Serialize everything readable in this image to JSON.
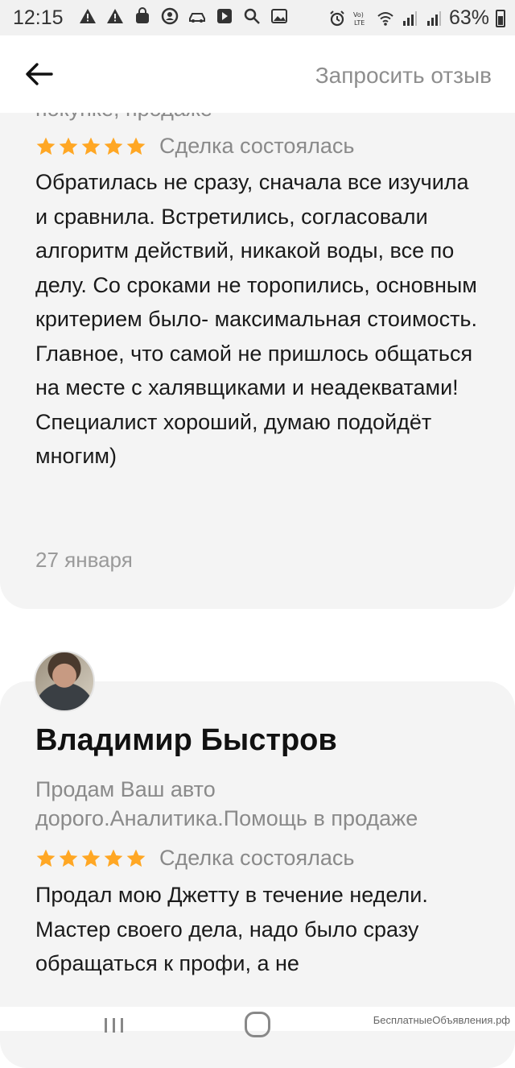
{
  "status_bar": {
    "time": "12:15",
    "battery": "63%",
    "icons_left": [
      "warning-icon",
      "warning-icon",
      "bag-icon",
      "face-icon",
      "car-icon",
      "arrow-icon",
      "search-icon",
      "image-icon"
    ],
    "icons_right": [
      "alarm-icon",
      "volte-icon",
      "wifi-icon",
      "signal-icon",
      "signal-icon",
      "battery-icon"
    ]
  },
  "header": {
    "back_icon": "arrow-left-icon",
    "request_review_label": "Запросить отзыв"
  },
  "reviews": [
    {
      "clipped_text": "покупке, продаже",
      "stars": 5,
      "deal_status": "Сделка состоялась",
      "text": "Обратилась не сразу, сначала все изучила и сравнила. Встретились, согласовали алгоритм действий, никакой воды, все по делу. Со сроками не торопились, основным критерием было- максимальная стоимость. Главное, что самой не пришлось общаться на месте с халявщиками и неадекватами! Специалист хороший, думаю подойдёт многим)",
      "date": "27 января"
    },
    {
      "reviewer_name": "Владимир Быстров",
      "reviewer_sub": "Продам Ваш авто дорого.Аналитика.Помощь в продаже",
      "stars": 5,
      "deal_status": "Сделка состоялась",
      "text": "Продал мою Джетту в течение недели. Мастер своего дела, надо было сразу обращаться к профи, а не"
    }
  ],
  "watermark": "БесплатныеОбъявления.рф",
  "colors": {
    "star": "#ffa724",
    "card_bg": "#f4f4f4",
    "secondary_text": "#8a8a8a"
  }
}
